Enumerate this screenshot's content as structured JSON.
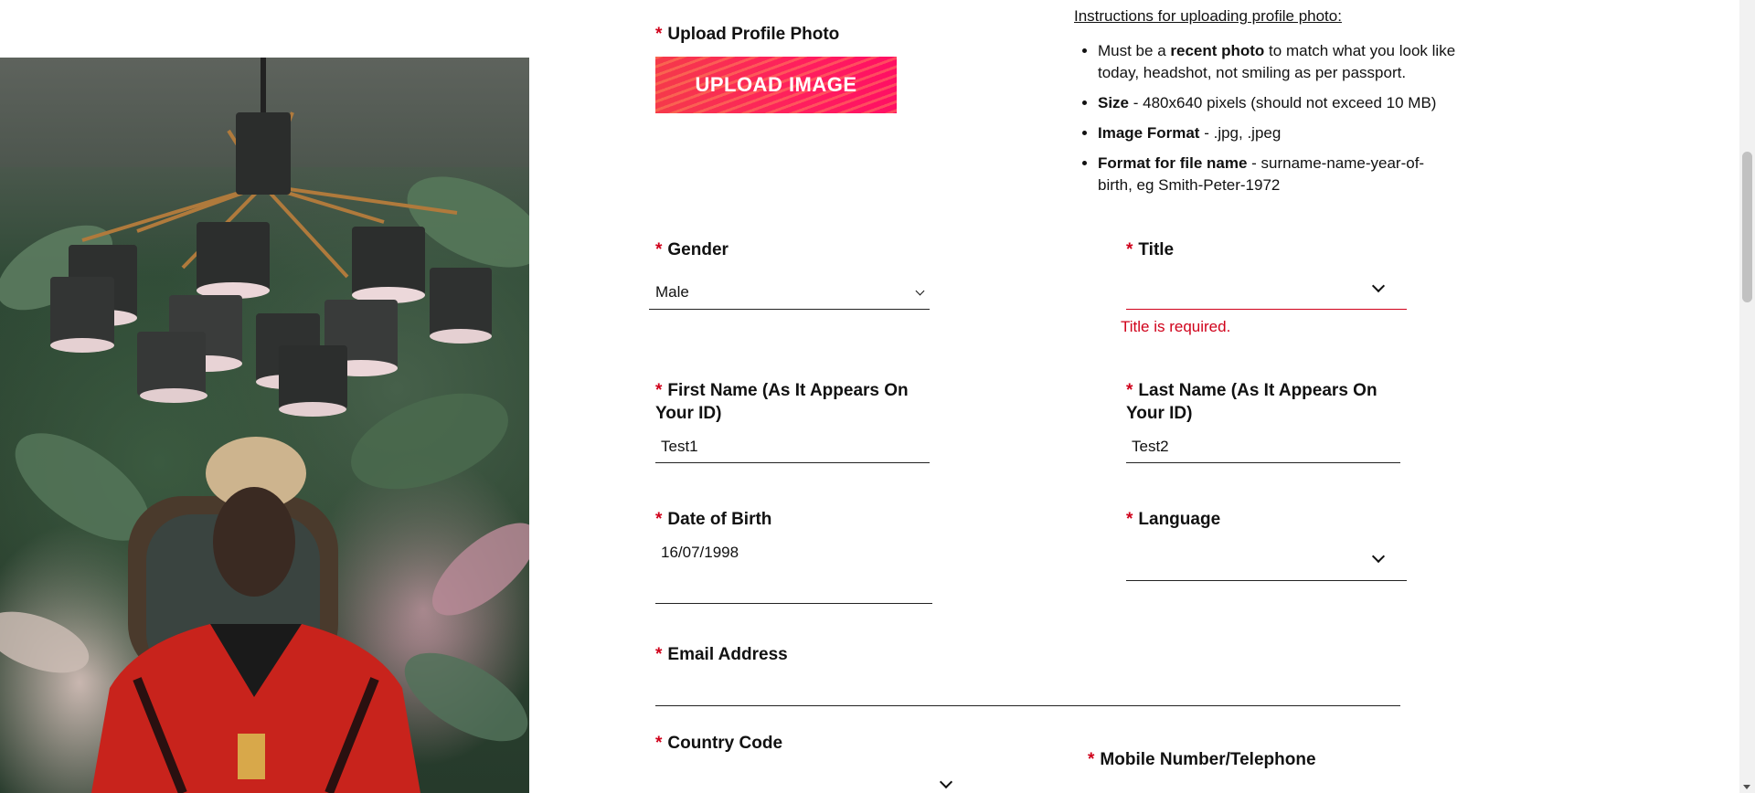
{
  "upload": {
    "label": "Upload Profile Photo",
    "button_label": "UPLOAD IMAGE"
  },
  "instructions": {
    "heading": "Instructions for uploading profile photo:",
    "items": [
      {
        "bold": "recent photo",
        "pre": "Must be a ",
        "post": " to match what you look like today, headshot, not smiling as per passport."
      },
      {
        "bold": "Size",
        "pre": "",
        "post": " - 480x640 pixels (should not exceed 10 MB)"
      },
      {
        "bold": "Image Format",
        "pre": "",
        "post": " - .jpg, .jpeg"
      },
      {
        "bold": "Format for file name",
        "pre": "",
        "post": " - surname-name-year-of-birth, eg Smith-Peter-1972"
      }
    ]
  },
  "form": {
    "required_marker": "*",
    "gender": {
      "label": "Gender",
      "value": "Male"
    },
    "title": {
      "label": "Title",
      "value": "",
      "error": "Title is required."
    },
    "first_name": {
      "label": "First Name (As It Appears On Your ID)",
      "value": "Test1"
    },
    "last_name": {
      "label": "Last Name (As It Appears On Your ID)",
      "value": "Test2"
    },
    "dob": {
      "label": "Date of Birth",
      "value": "16/07/1998"
    },
    "language": {
      "label": "Language",
      "value": ""
    },
    "email": {
      "label": "Email Address",
      "value": ""
    },
    "country_code": {
      "label": "Country Code",
      "value": ""
    },
    "mobile": {
      "label": "Mobile Number/Telephone",
      "value": ""
    }
  },
  "colors": {
    "required": "#d0021b",
    "error": "#d0021b",
    "upload_button": "#ff1f5e"
  }
}
